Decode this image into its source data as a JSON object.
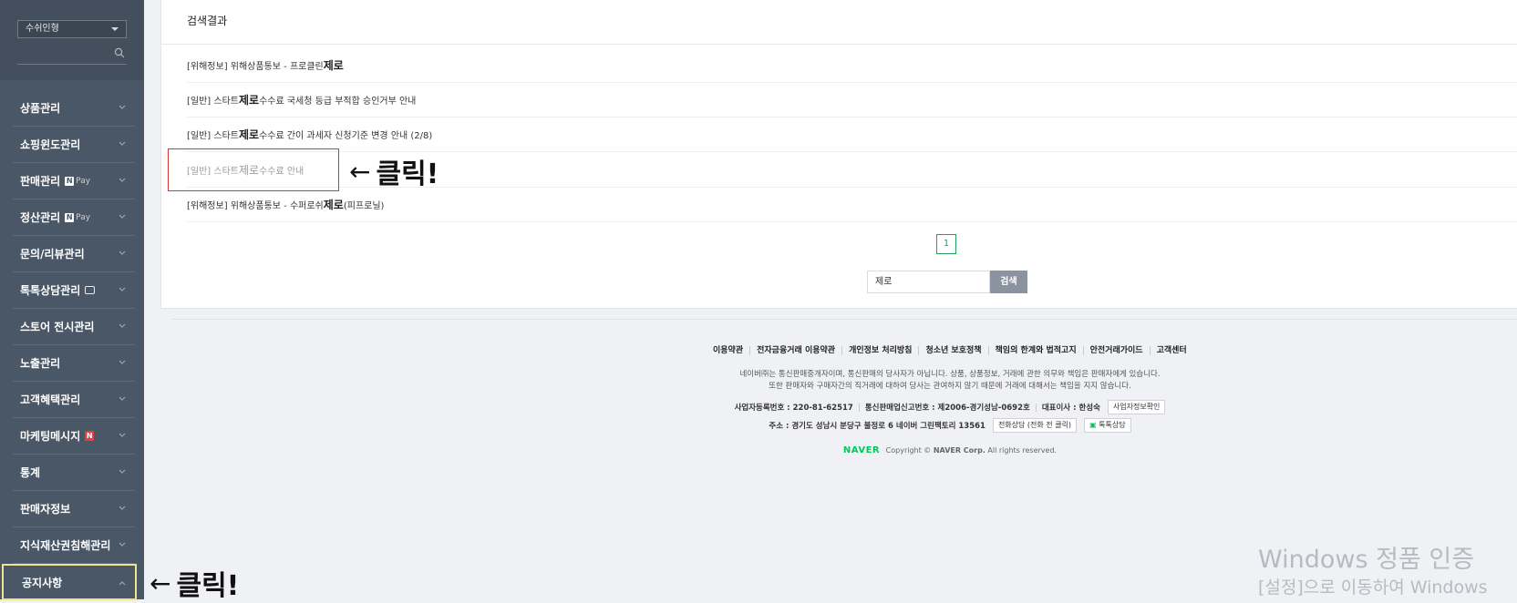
{
  "sidebar": {
    "store_select": "수쉬인형",
    "menu": [
      {
        "label": "상품관리"
      },
      {
        "label": "쇼핑윈도관리"
      },
      {
        "label": "판매관리",
        "pay": "Pay"
      },
      {
        "label": "정산관리",
        "pay": "Pay"
      },
      {
        "label": "문의/리뷰관리"
      },
      {
        "label": "톡톡상담관리"
      },
      {
        "label": "스토어 전시관리"
      },
      {
        "label": "노출관리"
      },
      {
        "label": "고객혜택관리"
      },
      {
        "label": "마케팅메시지",
        "badge": "N"
      },
      {
        "label": "통계"
      },
      {
        "label": "판매자정보"
      },
      {
        "label": "지식재산권침해관리"
      },
      {
        "label": "공지사항"
      }
    ]
  },
  "main": {
    "title": "검색결과",
    "results": [
      {
        "prefix": "[위해정보] 위해상품통보 - 프로클린",
        "highlight": "제로",
        "suffix": ""
      },
      {
        "prefix": "[일반] 스타트 ",
        "highlight": "제로",
        "suffix": "수수료 국세청 등급 부적합 승인거부 안내"
      },
      {
        "prefix": "[일반] 스타트 ",
        "highlight": "제로",
        "suffix": "수수료 간이 과세자 신청기준 변경 안내 (2/8)"
      },
      {
        "prefix": "[일반] 스타트 ",
        "highlight": "제로",
        "suffix": "수수료 안내"
      },
      {
        "prefix": "[위해정보] 위해상품통보 - 수퍼로쉬",
        "highlight": "제로",
        "suffix": "(피프로닐)"
      }
    ],
    "page": "1",
    "search_value": "제로",
    "search_button": "검색"
  },
  "annotations": {
    "click_result": "클릭!",
    "click_notice": "클릭!",
    "arrow": "←"
  },
  "footer": {
    "links": [
      "이용약관",
      "전자금융거래 이용약관",
      "개인정보 처리방침",
      "청소년 보호정책",
      "책임의 한계와 법적고지",
      "안전거래가이드",
      "고객센터"
    ],
    "notice1": "네이버㈜는 통신판매중개자이며, 통신판매의 당사자가 아닙니다. 상품, 상품정보, 거래에 관한 의무와 책임은 판매자에게 있습니다.",
    "notice2": "또한 판매자와 구매자간의 직거래에 대하여 당사는 관여하지 않기 때문에 거래에 대해서는 책임을 지지 않습니다.",
    "biz_no": "사업자등록번호 : 220-81-62517",
    "mail_order_no": "통신판매업신고번호 : 제2006-경기성남-0692호",
    "ceo": "대표이사 : 한성숙",
    "biz_info_button": "사업자정보확인",
    "address": "주소 : 경기도 성남시 분당구 불정로 6 네이버 그린팩토리 13561",
    "phone_button": "전화상담 (전화 전 클릭)",
    "talk_button": "톡톡상담",
    "logo": "NAVER",
    "copyright_pre": "Copyright ©",
    "copyright_corp": "NAVER Corp.",
    "copyright_post": "All rights reserved."
  },
  "watermark": {
    "line1": "Windows 정품 인증",
    "line2": "[설정]으로 이동하여 Windows"
  },
  "colors": {
    "sidebar_bg": "#4a5766",
    "highlight_box": "#f3e28c",
    "red_box": "#dd3333",
    "pager_green": "#21a35a",
    "naver_green": "#03c75a"
  }
}
